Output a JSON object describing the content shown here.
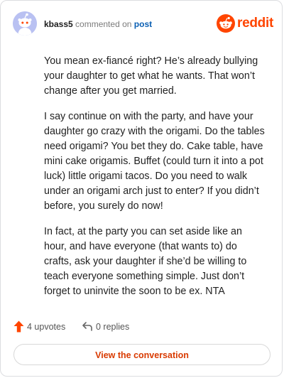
{
  "header": {
    "username": "kbass5",
    "action_text": "commented on",
    "post_link": "post",
    "brand_name": "reddit",
    "brand_color": "#ff4500"
  },
  "comment": {
    "paragraphs": [
      "You mean ex-fiancé right? He’s already bullying your daughter to get what he wants. That won’t change after you get married.",
      "I say continue on with the party, and have your daughter go crazy with the origami. Do the tables need origami? You bet they do. Cake table, have mini cake origamis. Buffet (could turn it into a pot luck) little origami tacos. Do you need to walk under an origami arch just to enter? If you didn’t before, you surely do now!",
      "In fact, at the party you can set aside like an hour, and have everyone (that wants to) do crafts, ask your daughter if she’d be willing to teach everyone something simple. Just don’t forget to uninvite the soon to be ex. NTA"
    ]
  },
  "actions": {
    "upvotes": "4 upvotes",
    "replies": "0 replies",
    "upvote_icon": "upvote-arrow-icon",
    "reply_icon": "reply-arrow-icon"
  },
  "cta": {
    "label": "View the conversation"
  }
}
